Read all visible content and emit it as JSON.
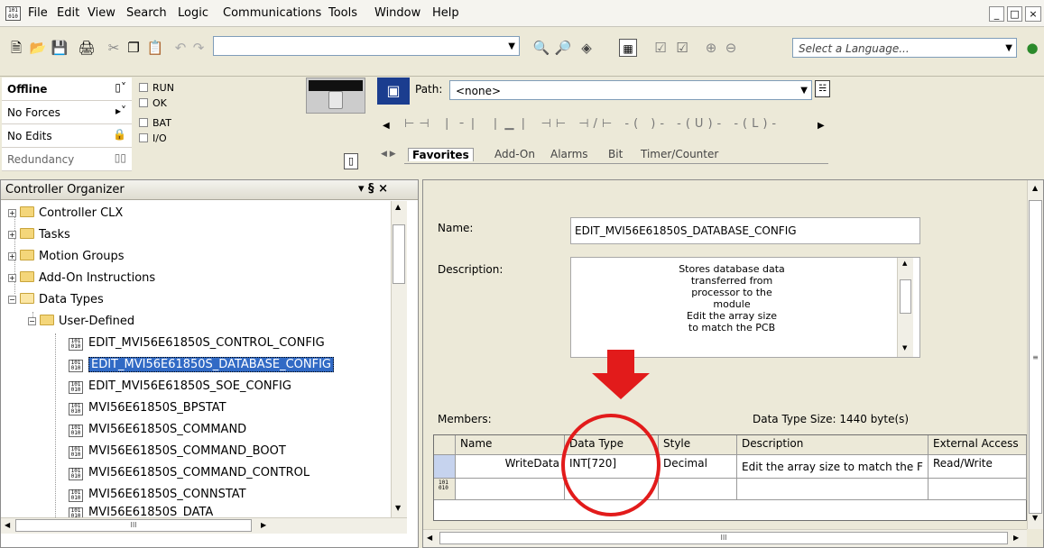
{
  "menubar": {
    "items": [
      "File",
      "Edit",
      "View",
      "Search",
      "Logic",
      "Communications",
      "Tools",
      "Window",
      "Help"
    ],
    "controls": [
      "_",
      "□",
      "×"
    ]
  },
  "toolbar": {
    "language_placeholder": "Select a Language...",
    "path_label": "Path:",
    "path_value": "<none>",
    "tabs": [
      "Favorites",
      "Add-On",
      "Alarms",
      "Bit",
      "Timer/Counter"
    ]
  },
  "status": {
    "rows": [
      "Offline",
      "No Forces",
      "No Edits",
      "Redundancy"
    ],
    "checks": [
      "RUN",
      "OK",
      "BAT",
      "I/O"
    ]
  },
  "organizer": {
    "title": "Controller Organizer",
    "title_controls": "▾ § ×",
    "items": [
      "Controller CLX",
      "Tasks",
      "Motion Groups",
      "Add-On Instructions",
      "Data Types",
      "User-Defined",
      "EDIT_MVI56E61850S_CONTROL_CONFIG",
      "EDIT_MVI56E61850S_DATABASE_CONFIG",
      "EDIT_MVI56E61850S_SOE_CONFIG",
      "MVI56E61850S_BPSTAT",
      "MVI56E61850S_COMMAND",
      "MVI56E61850S_COMMAND_BOOT",
      "MVI56E61850S_COMMAND_CONTROL",
      "MVI56E61850S_CONNSTAT",
      "MVI56E61850S_DATA"
    ],
    "scroll_h_label": "III"
  },
  "editor": {
    "name_label": "Name:",
    "name_value": "EDIT_MVI56E61850S_DATABASE_CONFIG",
    "description_label": "Description:",
    "description_lines": [
      "Stores database data",
      "transferred from",
      "processor to the",
      "module",
      "Edit the array size",
      "to match the PCB"
    ],
    "members_label": "Members:",
    "size_label": "Data Type Size: 1440 byte(s)",
    "columns": [
      "Name",
      "Data Type",
      "Style",
      "Description",
      "External Access"
    ],
    "row": {
      "name": "WriteData",
      "type": "INT[720]",
      "style": "Decimal",
      "description": "Edit the array size to match the F",
      "access": "Read/Write"
    },
    "scroll_h_label": "III"
  },
  "colors": {
    "annotation_red": "#e21b1b",
    "selection_blue": "#316ac5"
  }
}
